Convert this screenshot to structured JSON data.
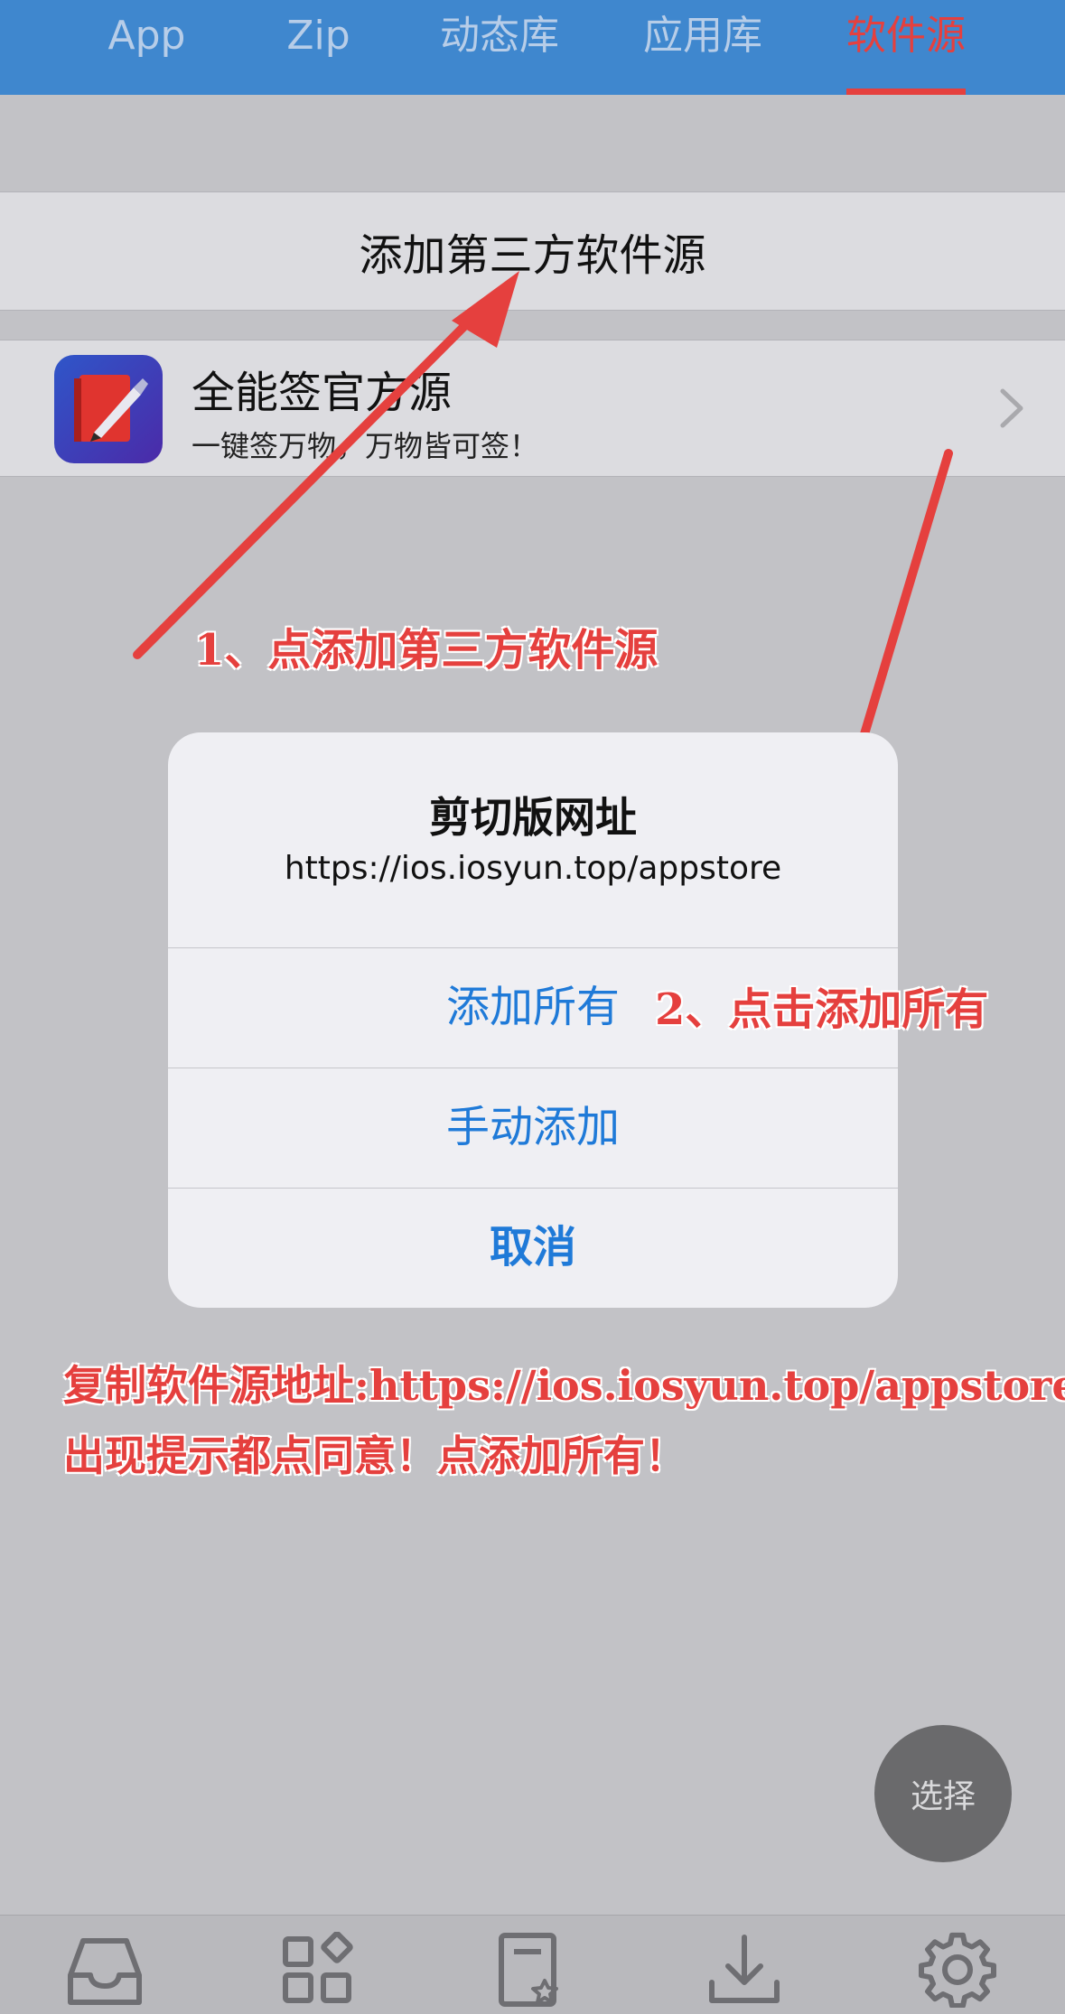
{
  "top_tabs": [
    {
      "label": "App",
      "active": false
    },
    {
      "label": "Zip",
      "active": false
    },
    {
      "label": "动态库",
      "active": false
    },
    {
      "label": "应用库",
      "active": false
    },
    {
      "label": "软件源",
      "active": true
    }
  ],
  "add_source": {
    "label": "添加第三方软件源"
  },
  "sources": [
    {
      "name": "全能签官方源",
      "description": "一键签万物，万物皆可签！",
      "icon": "pen-book-icon"
    }
  ],
  "dialog": {
    "title": "剪切版网址",
    "message": "https://ios.iosyun.top/appstore",
    "buttons": {
      "add_all": "添加所有",
      "manual_add": "手动添加",
      "cancel": "取消"
    }
  },
  "annotations": {
    "step1": "1、点添加第三方软件源",
    "step2": "2、点击添加所有",
    "note_line1": "复制软件源地址:https://ios.iosyun.top/appstore",
    "note_line2": "出现提示都点同意！点添加所有！"
  },
  "fab": {
    "label": "选择"
  },
  "bottom_tabs": [
    {
      "icon": "inbox-icon"
    },
    {
      "icon": "apps-grid-icon"
    },
    {
      "icon": "certificate-icon"
    },
    {
      "icon": "download-icon"
    },
    {
      "icon": "gear-icon"
    }
  ],
  "colors": {
    "topbar": "#3f87ce",
    "active_tab": "#e5403e",
    "dialog_button": "#1f7ad8",
    "annotation": "#e5403e"
  }
}
